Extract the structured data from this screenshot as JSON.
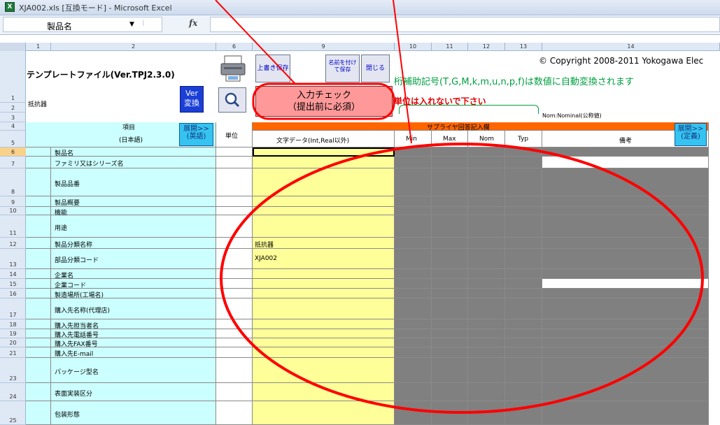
{
  "window": {
    "title": "XJA002.xls  [互換モード] - Microsoft Excel",
    "app_icon": "excel-icon"
  },
  "formula_bar": {
    "name_box_value": "製品名",
    "fx_label": "fx",
    "formula_value": ""
  },
  "columns": [
    "1",
    "2",
    "6",
    "9",
    "10",
    "11",
    "12",
    "13",
    "14"
  ],
  "rows": [
    "1",
    "2",
    "3",
    "4",
    "5",
    "6",
    "7",
    "8",
    "9",
    "10",
    "11",
    "12",
    "13",
    "14",
    "15",
    "16",
    "17",
    "18",
    "19",
    "20",
    "21",
    "23",
    "24",
    "25"
  ],
  "sheet_header": {
    "template_title": "テンプレートファイル(Ver.TPJ2.3.0)",
    "category": "抵抗器",
    "copyright": "© Copyright 2008-2011 Yokogawa Elec",
    "note_green": "桁補助記号(T,G,M,k,m,u,n,p,f)は数値に自動変換されます",
    "note_red": "単位は入れないで下さい",
    "nom_note": "Nom:Nominal(公称値)"
  },
  "buttons": {
    "overwrite_save": "上書き保存",
    "save_as": "名前を付けて保存",
    "close": "閉じる",
    "ver_convert_line1": "Ver",
    "ver_convert_line2": "変換",
    "input_check_line1": "入力チェック",
    "input_check_line2": "（提出前に必須）",
    "expand_english_line1": "展開>>",
    "expand_english_line2": "(英語)",
    "expand_definition_line1": "展開>>",
    "expand_definition_line2": "(定義)",
    "print_icon": "printer-icon",
    "search_icon": "magnifier-icon"
  },
  "table_headers": {
    "item": "項目",
    "item_japanese": "(日本語)",
    "unit": "単位",
    "supplier_answer": "サプライヤ回答記入欄",
    "text_data": "文字データ(Int,Real以外)",
    "min": "Min",
    "max": "Max",
    "nom": "Nom",
    "typ": "Typ",
    "remarks": "備考"
  },
  "items": [
    {
      "row": "6",
      "label": "製品名",
      "value": ""
    },
    {
      "row": "7",
      "label": "ファミリ又はシリーズ名",
      "value": ""
    },
    {
      "row": "8",
      "label": "製品品番",
      "value": ""
    },
    {
      "row": "9",
      "label": "製品概要",
      "value": ""
    },
    {
      "row": "10",
      "label": "機能",
      "value": ""
    },
    {
      "row": "11",
      "label": "用途",
      "value": ""
    },
    {
      "row": "12",
      "label": "製品分類名称",
      "value": "抵抗器"
    },
    {
      "row": "13",
      "label": "部品分類コード",
      "value": "XJA002"
    },
    {
      "row": "14",
      "label": "企業名",
      "value": ""
    },
    {
      "row": "15",
      "label": "企業コード",
      "value": ""
    },
    {
      "row": "16",
      "label": "製造場所(工場名)",
      "value": ""
    },
    {
      "row": "17",
      "label": "購入先名称(代理店)",
      "value": ""
    },
    {
      "row": "18",
      "label": "購入先担当者名",
      "value": ""
    },
    {
      "row": "19",
      "label": "購入先電話番号",
      "value": ""
    },
    {
      "row": "20",
      "label": "購入先FAX番号",
      "value": ""
    },
    {
      "row": "21",
      "label": "購入先E-mail",
      "value": ""
    },
    {
      "row": "23",
      "label": "パッケージ型名",
      "value": ""
    },
    {
      "row": "24",
      "label": "表面実装区分",
      "value": ""
    },
    {
      "row": "25",
      "label": "包装形態",
      "value": ""
    }
  ],
  "colors": {
    "cyan_fill": "#ccffff",
    "yellow_fill": "#ffff99",
    "gray_fill": "#808080",
    "orange_header": "#ff6600",
    "salmon_button": "#ff9999",
    "annotation_red": "#ff0000"
  }
}
